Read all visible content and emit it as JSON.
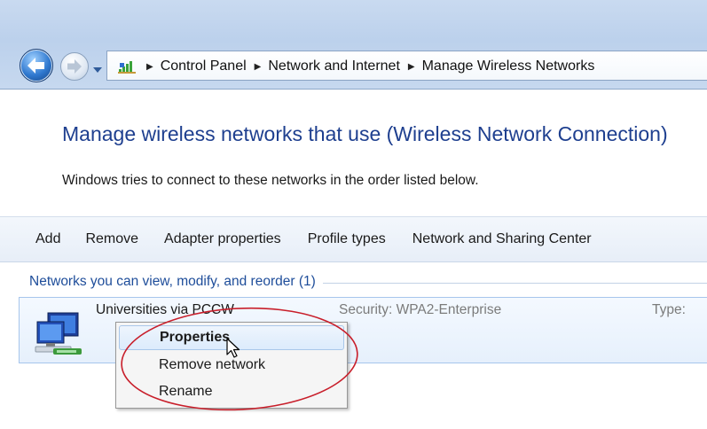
{
  "nav": {
    "back_icon": "back-arrow-icon",
    "forward_icon": "forward-arrow-icon",
    "recent_pages_icon": "chevron-down-icon"
  },
  "address": {
    "icon": "network-signal-icon",
    "crumbs": [
      "Control Panel",
      "Network and Internet",
      "Manage Wireless Networks"
    ]
  },
  "page": {
    "title": "Manage wireless networks that use (Wireless Network Connection)",
    "description": "Windows tries to connect to these networks in the order listed below."
  },
  "toolbar": {
    "items": [
      "Add",
      "Remove",
      "Adapter properties",
      "Profile types",
      "Network and Sharing Center"
    ]
  },
  "networks": {
    "group_title": "Networks you can view, modify, and reorder (1)",
    "items": [
      {
        "name": "Universities via PCCW",
        "security": "Security: WPA2-Enterprise",
        "type": "Type:"
      }
    ]
  },
  "context_menu": {
    "items": [
      "Properties",
      "Remove network",
      "Rename"
    ],
    "default_item": "Properties",
    "hovered_item": "Properties"
  },
  "colors": {
    "title_blue": "#1e3f8f",
    "annotation_red": "#c81e2a",
    "selection_border": "#a7c6ec"
  }
}
